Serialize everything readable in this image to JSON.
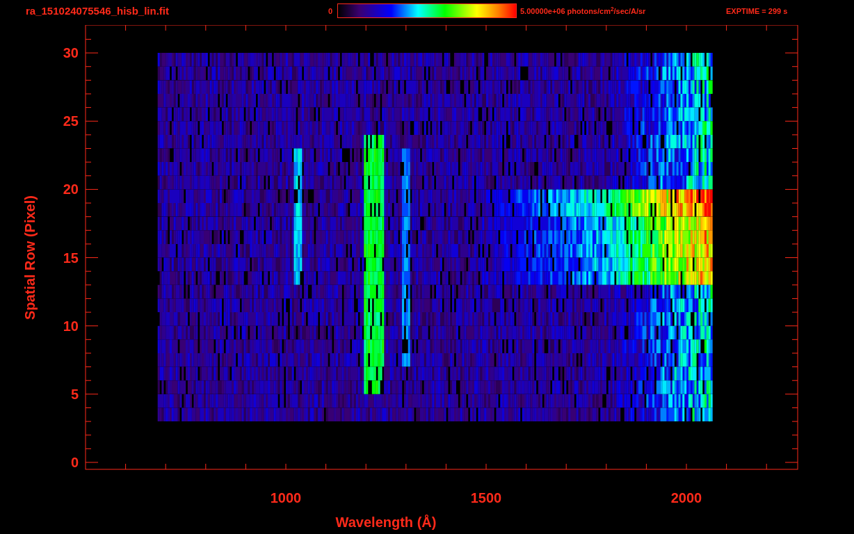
{
  "title": "ra_151024075546_hisb_lin.fit",
  "colorbar": {
    "min_label": "0",
    "max_label": "5.00000e+06 photons/cm$^{2}$/sec/A/sr"
  },
  "exposure": "EXPTIME = 299 s",
  "plot": {
    "xlabel": "Wavelength (Å)",
    "ylabel": "Spatial Row (Pixel)",
    "xtick_labels": [
      "1000",
      "1500",
      "2000"
    ],
    "ytick_labels": [
      "30",
      "25",
      "20",
      "15",
      "10",
      "5",
      "0"
    ]
  }
}
